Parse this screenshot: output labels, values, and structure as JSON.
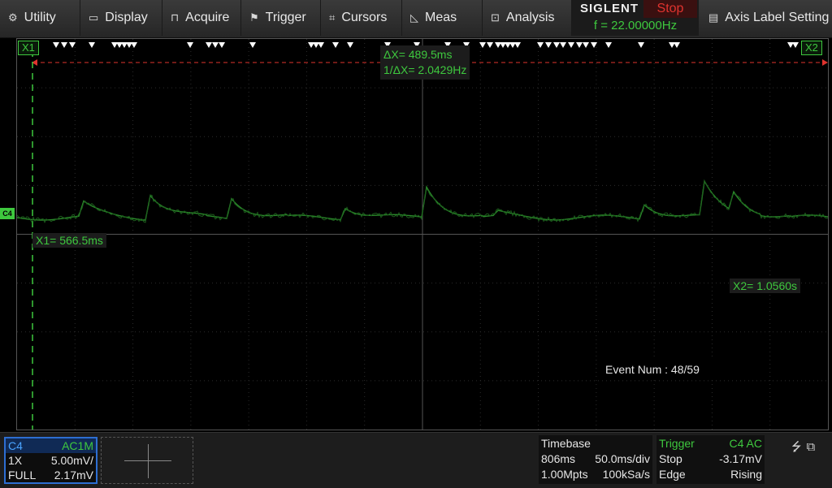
{
  "menu": {
    "items": [
      {
        "icon": "gear-icon",
        "glyph": "⚙",
        "label": "Utility"
      },
      {
        "icon": "display-icon",
        "glyph": "▭",
        "label": "Display"
      },
      {
        "icon": "acquire-icon",
        "glyph": "⊓",
        "label": "Acquire"
      },
      {
        "icon": "trigger-flag-icon",
        "glyph": "⚑",
        "label": "Trigger"
      },
      {
        "icon": "cursors-icon",
        "glyph": "⌗",
        "label": "Cursors"
      },
      {
        "icon": "meas-icon",
        "glyph": "◺",
        "label": "Meas"
      },
      {
        "icon": "analysis-icon",
        "glyph": "⊡",
        "label": "Analysis"
      }
    ],
    "right_item": {
      "icon": "document-icon",
      "glyph": "▤",
      "label": "Axis Label Setting"
    }
  },
  "brand": {
    "name": "SIGLENT",
    "status": "Stop",
    "frequency": "f = 22.00000Hz"
  },
  "cursors": {
    "x1_tag": "X1",
    "x2_tag": "X2",
    "x1_readout": "X1= 566.5ms",
    "x2_readout": "X2= 1.0560s",
    "delta_x": "ΔX= 489.5ms",
    "inv_delta_x": "1/ΔX= 2.0429Hz"
  },
  "event_num": "Event Num : 48/59",
  "channel_marker": "C4",
  "channel": {
    "name": "C4",
    "coupling": "AC1M",
    "probe": "1X",
    "scale": "5.00mV/",
    "bandwidth": "FULL",
    "offset": "2.17mV"
  },
  "timebase": {
    "title": "Timebase",
    "delay": "806ms",
    "scale": "50.0ms/div",
    "memory": "1.00Mpts",
    "sample_rate": "100kSa/s"
  },
  "trigger": {
    "title": "Trigger",
    "source": "C4 AC",
    "state": "Stop",
    "level": "-3.17mV",
    "type": "Edge",
    "slope": "Rising"
  },
  "colors": {
    "trace": "#2a8a2a",
    "cursor": "#3ec83e",
    "marker_line": "#e0332e",
    "channel_box": "#2d6ed2"
  }
}
